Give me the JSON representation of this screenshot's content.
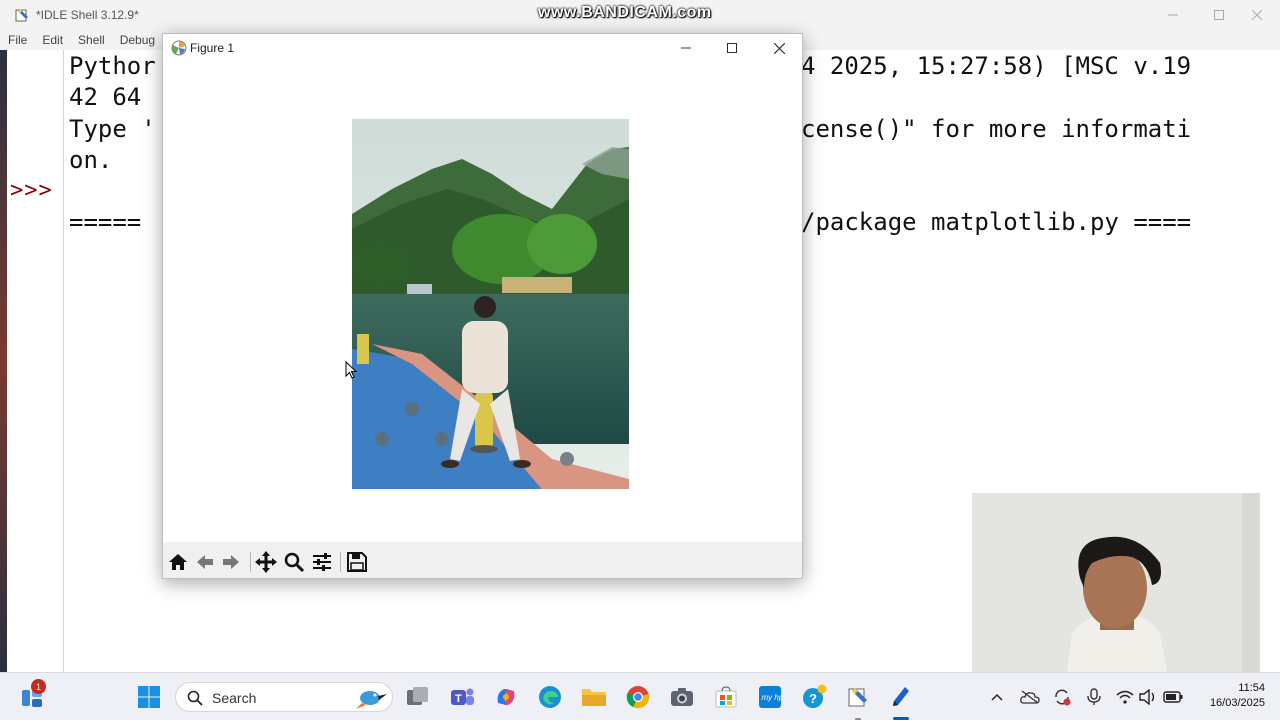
{
  "idle": {
    "title": "*IDLE Shell 3.12.9*",
    "menu": [
      "File",
      "Edit",
      "Shell",
      "Debug"
    ],
    "prompt": ">>>",
    "lines": [
      {
        "id": "l1a",
        "text": "Pythor"
      },
      {
        "id": "l1b",
        "text": "4 2025, 15:27:58) [MSC v.19"
      },
      {
        "id": "l2",
        "text": "42 64"
      },
      {
        "id": "l3a",
        "text": "Type '"
      },
      {
        "id": "l3b",
        "text": "cense()\" for more informati"
      },
      {
        "id": "l4",
        "text": "on."
      },
      {
        "id": "l5a",
        "text": "====="
      },
      {
        "id": "l5b",
        "text": "/package matplotlib.py ===="
      }
    ]
  },
  "figure": {
    "title": "Figure 1",
    "toolbar": [
      "home-icon",
      "back-arrow-icon",
      "forward-arrow-icon",
      "pan-icon",
      "zoom-icon",
      "configure-subplots-icon",
      "save-icon"
    ]
  },
  "watermark": "www.BANDICAM.com",
  "taskbar": {
    "notification_count": "1",
    "search_label": "Search",
    "pinned": [
      "widgets-icon",
      "start-icon",
      "task-view-icon",
      "teams-icon",
      "copilot-icon",
      "edge-icon",
      "file-explorer-icon",
      "chrome-icon",
      "camera-icon",
      "store-icon",
      "hp-icon",
      "help-icon",
      "idle-taskbar-icon",
      "pen-app-icon"
    ],
    "tray": [
      "chevron-up-icon",
      "onedrive-icon",
      "sync-icon",
      "mic-icon",
      "wifi-icon",
      "volume-icon",
      "battery-icon"
    ],
    "time": "11:54",
    "date": "16/03/2025"
  },
  "colors": {
    "prompt": "#8b0000",
    "accent": "#005fb8",
    "badge": "#c42b1c"
  }
}
